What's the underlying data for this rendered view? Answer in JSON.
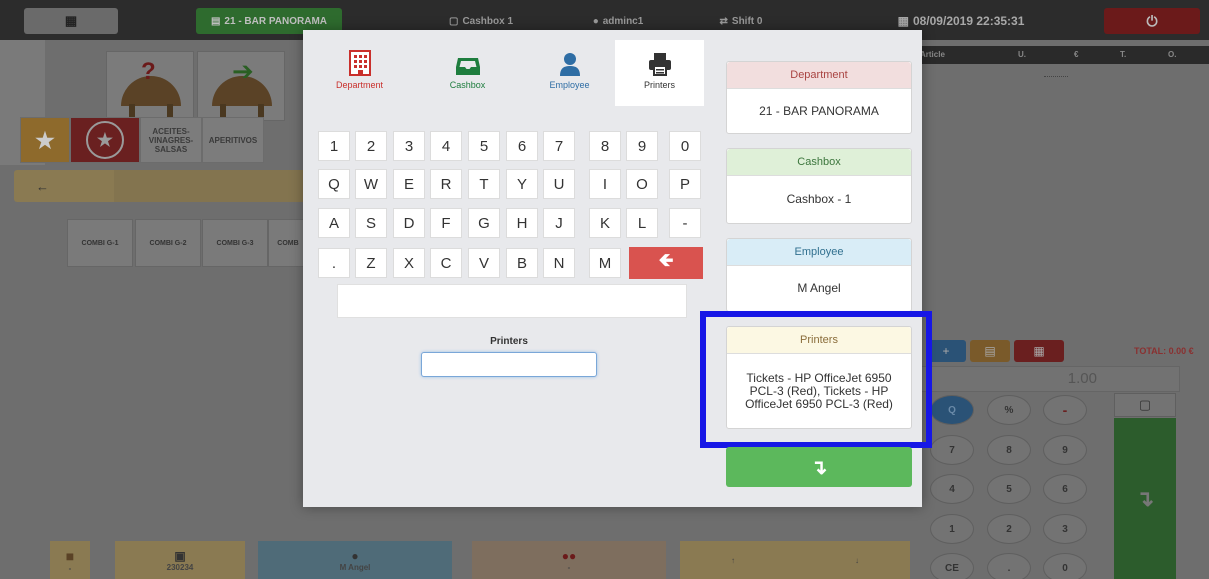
{
  "topbar": {
    "grid_icon": "grid-icon",
    "department": "21 - BAR PANORAMA",
    "cashbox": "Cashbox 1",
    "user": "adminc1",
    "shift": "Shift 0",
    "datetime": "08/09/2019 22:35:31",
    "power_icon": "power-icon"
  },
  "categories": [
    "ACEITES-VINAGRES-SALSAS",
    "APERITIVOS"
  ],
  "combis": [
    "COMBI G-1",
    "COMBI G-2",
    "COMBI G-3",
    "COMB"
  ],
  "order_header": {
    "article": "Article",
    "u": "U.",
    "euro": "€",
    "t": "T.",
    "o": "O."
  },
  "total": "TOTAL: 0.00 €",
  "quantity": "1.00",
  "numpad": [
    "Q",
    "%",
    "-",
    "7",
    "8",
    "9",
    "4",
    "5",
    "6",
    "1",
    "2",
    "3",
    "CE",
    ".",
    "0"
  ],
  "bottom": {
    "table_label": "-",
    "ticket_number": "230234",
    "employee": "M Angel",
    "guests": "-",
    "up": "↑",
    "down": "↓"
  },
  "modal": {
    "tabs": [
      {
        "label": "Department",
        "icon": "building-icon",
        "color": "#c9302c"
      },
      {
        "label": "Cashbox",
        "icon": "inbox-icon",
        "color": "#1e7d3e"
      },
      {
        "label": "Employee",
        "icon": "user-icon",
        "color": "#2e6da4"
      },
      {
        "label": "Printers",
        "icon": "printer-icon",
        "color": "#333333"
      }
    ],
    "keyboard": {
      "row1": [
        "1",
        "2",
        "3",
        "4",
        "5",
        "6",
        "7",
        "8",
        "9",
        "0"
      ],
      "row2": [
        "Q",
        "W",
        "E",
        "R",
        "T",
        "Y",
        "U",
        "I",
        "O",
        "P"
      ],
      "row3": [
        "A",
        "S",
        "D",
        "F",
        "G",
        "H",
        "J",
        "K",
        "L",
        "-"
      ],
      "row4": [
        ".",
        "Z",
        "X",
        "C",
        "V",
        "B",
        "N",
        "M"
      ],
      "backspace_icon": "arrow-left-icon"
    },
    "field_label": "Printers",
    "field_value": "",
    "cards": {
      "department": {
        "title": "Department",
        "value": "21 - BAR PANORAMA",
        "header_bg": "#f2dede",
        "header_color": "#a94442"
      },
      "cashbox": {
        "title": "Cashbox",
        "value": "Cashbox - 1",
        "header_bg": "#dff0d8",
        "header_color": "#3c763d"
      },
      "employee": {
        "title": "Employee",
        "value": "M Angel",
        "header_bg": "#d9edf7",
        "header_color": "#31708f"
      },
      "printers": {
        "title": "Printers",
        "value": "Tickets - HP OfficeJet 6950 PCL-3 (Red), Tickets - HP OfficeJet 6950 PCL-3 (Red)",
        "header_bg": "#fcf8e3",
        "header_color": "#8a6d3b"
      }
    },
    "confirm_icon": "enter-arrow-icon",
    "highlight_color": "#1717e6"
  }
}
